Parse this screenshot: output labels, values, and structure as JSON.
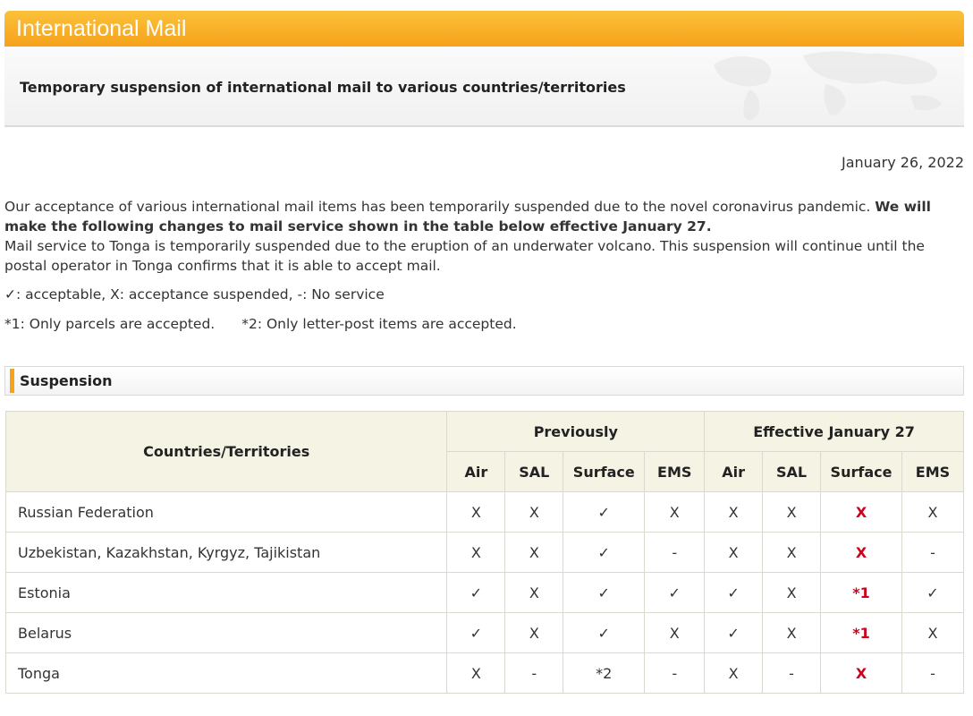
{
  "header": {
    "title": "International Mail"
  },
  "subheader": {
    "subtitle": "Temporary suspension of international mail to various countries/territories"
  },
  "date": "January 26, 2022",
  "intro": {
    "p1_normal": "Our acceptance of various international mail items has been temporarily suspended due to the novel coronavirus pandemic. ",
    "p1_bold": "We will make the following changes to mail service shown in the table below effective January 27.",
    "p2": "Mail service to Tonga is temporarily suspended due to the eruption of an underwater volcano. This suspension will continue until the postal operator in Tonga confirms that it is able to accept mail."
  },
  "legend": "✓: acceptable, X: acceptance suspended, -: No service",
  "notes": {
    "n1": "*1: Only parcels are accepted.",
    "n2": "*2: Only letter-post items are accepted."
  },
  "section": {
    "label": "Suspension"
  },
  "table": {
    "col_country": "Countries/Territories",
    "group_prev": "Previously",
    "group_eff": "Effective January 27",
    "subcols": [
      "Air",
      "SAL",
      "Surface",
      "EMS",
      "Air",
      "SAL",
      "Surface",
      "EMS"
    ],
    "rows": [
      {
        "country": "Russian Federation",
        "cells": [
          "X",
          "X",
          "✓",
          "X",
          "X",
          "X",
          "X",
          "X"
        ],
        "red": [
          6
        ]
      },
      {
        "country": "Uzbekistan, Kazakhstan, Kyrgyz, Tajikistan",
        "cells": [
          "X",
          "X",
          "✓",
          "-",
          "X",
          "X",
          "X",
          "-"
        ],
        "red": [
          6
        ]
      },
      {
        "country": "Estonia",
        "cells": [
          "✓",
          "X",
          "✓",
          "✓",
          "✓",
          "X",
          "*1",
          "✓"
        ],
        "red": [
          6
        ]
      },
      {
        "country": "Belarus",
        "cells": [
          "✓",
          "X",
          "✓",
          "X",
          "✓",
          "X",
          "*1",
          "X"
        ],
        "red": [
          6
        ]
      },
      {
        "country": "Tonga",
        "cells": [
          "X",
          "-",
          "*2",
          "-",
          "X",
          "-",
          "X",
          "-"
        ],
        "red": [
          6
        ]
      }
    ]
  },
  "colors": {
    "header_orange": "#f6a21a",
    "table_header_bg": "#f4f3e4",
    "highlight_red": "#d0021b"
  }
}
